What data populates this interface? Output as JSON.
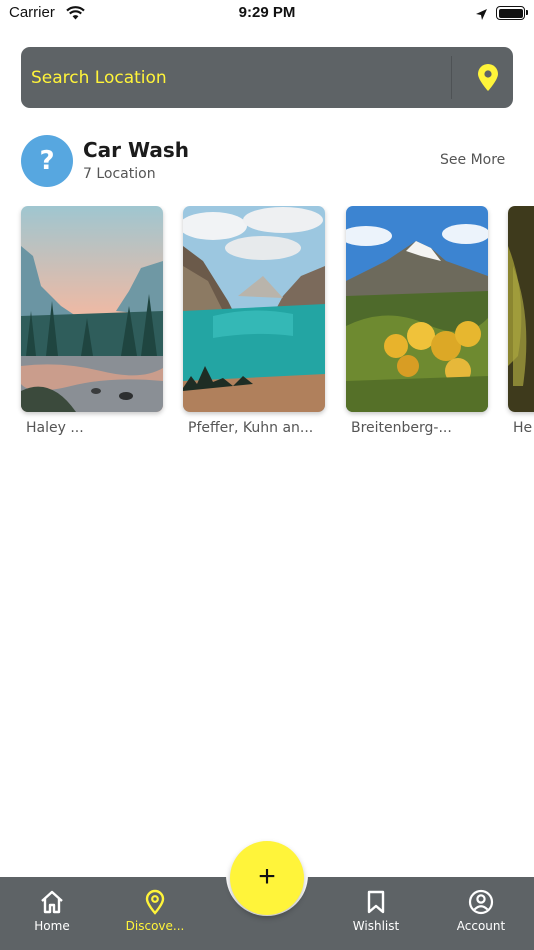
{
  "status_bar": {
    "carrier": "Carrier",
    "time": "9:29 PM"
  },
  "search": {
    "placeholder": "Search Location",
    "icon": "location-pin-icon"
  },
  "category": {
    "avatar_symbol": "?",
    "title": "Car Wash",
    "count_label": "7 Location",
    "see_more": "See More"
  },
  "locations": [
    {
      "name": "Haley ...",
      "image": "valley-sunset-photo"
    },
    {
      "name": "Pfeffer, Kuhn an...",
      "image": "fjord-lake-photo"
    },
    {
      "name": "Breitenberg-...",
      "image": "autumn-mountain-photo"
    },
    {
      "name": "He",
      "image": "dark-forest-photo"
    }
  ],
  "tabs": [
    {
      "label": "Home",
      "icon": "home-icon",
      "active": false
    },
    {
      "label": "Discove...",
      "icon": "location-pin-icon",
      "active": true
    },
    {
      "label": "Wishlist",
      "icon": "bookmark-icon",
      "active": false
    },
    {
      "label": "Account",
      "icon": "account-circle-icon",
      "active": false
    }
  ],
  "fab": {
    "symbol": "+"
  },
  "colors": {
    "accent_yellow": "#fff43a",
    "bar_gray": "#5e6366",
    "avatar_blue": "#57a7e0"
  }
}
